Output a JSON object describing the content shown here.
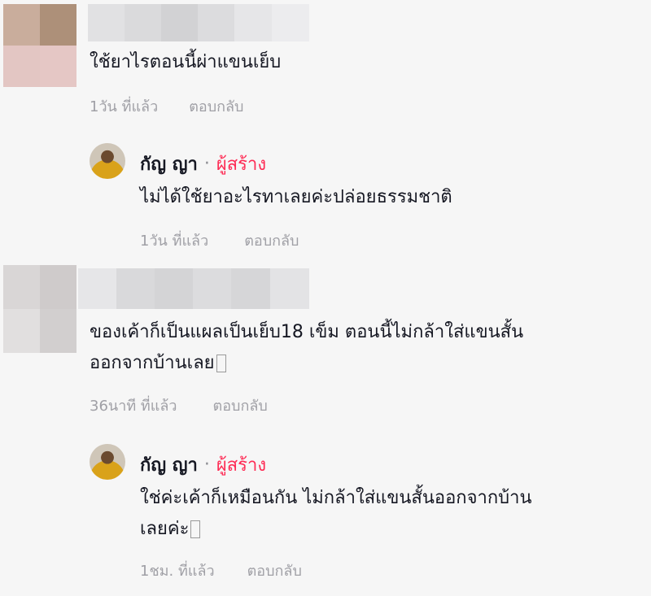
{
  "comments": [
    {
      "text": "ใช้ยาไรตอนนี้ผ่าแขนเย็บ",
      "time": "1วัน ที่แล้ว",
      "reply": "ตอบกลับ",
      "avatar_colors": [
        "#c9ad9c",
        "#ad9079",
        "#e3c6c3",
        "#e5c7c5"
      ],
      "name_colors": [
        "#e1e1e3",
        "#dadadc",
        "#d2d2d4",
        "#dcdcde",
        "#e6e6e8",
        "#ececee"
      ]
    },
    {
      "author": "กัญ ญา",
      "badge": "ผู้สร้าง",
      "dot": "·",
      "text": "ไม่ได้ใช้ยาอะไรทาเลยค่ะปล่อยธรรมชาติ",
      "time": "1วัน ที่แล้ว",
      "reply": "ตอบกลับ"
    },
    {
      "text_line1": "ของเค้าก็เป็นแผลเป็นเย็บ18 เข็ม ตอนนี้ไม่กล้าใส่แขนสั้น",
      "text_line2": "ออกจากบ้านเลย",
      "time": "36นาที ที่แล้ว",
      "reply": "ตอบกลับ",
      "avatar_colors": [
        "#d9d6d6",
        "#cfcbcb",
        "#e1dfdf",
        "#d2cfcf",
        "#e0dede",
        "#ebe9e9"
      ],
      "name_colors": [
        "#e6e6e8",
        "#d9d9db",
        "#d4d4d6",
        "#dcdcde",
        "#d6d6d8",
        "#e3e3e5"
      ]
    },
    {
      "author": "กัญ ญา",
      "badge": "ผู้สร้าง",
      "dot": "·",
      "text_line1": "ใช่ค่ะเค้าก็เหมือนกัน ไม่กล้าใส่แขนสั้นออกจากบ้าน",
      "text_line2": "เลยค่ะ",
      "time": "1ชม. ที่แล้ว",
      "reply": "ตอบกลับ"
    }
  ]
}
